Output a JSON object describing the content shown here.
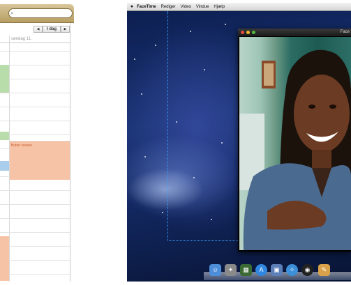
{
  "calendar": {
    "search": {
      "value": "",
      "placeholder": ""
    },
    "nav": {
      "prev": "◀",
      "today": "I dag",
      "next": "▶"
    },
    "day_header": "søndag 11.",
    "events": {
      "orange_title": "Butter reason"
    }
  },
  "menubar": {
    "apple": "",
    "items": [
      "FaceTime",
      "Rediger",
      "Video",
      "Vindue",
      "Hjælp"
    ]
  },
  "facetime": {
    "title": "Face"
  },
  "dock": {
    "icons": [
      "finder-icon",
      "rocket-icon",
      "mission-control-icon",
      "app-store-icon",
      "preview-icon",
      "safari-icon",
      "quicktime-icon",
      "notes-icon"
    ]
  },
  "colors": {
    "calendar_toolbar": "#b79e63",
    "event_green": "#b8dcaa",
    "event_blue": "#a9cdeb",
    "event_orange": "#f7c3a7",
    "guide_line": "#3aa0ff",
    "desktop_bg": "#183270"
  }
}
